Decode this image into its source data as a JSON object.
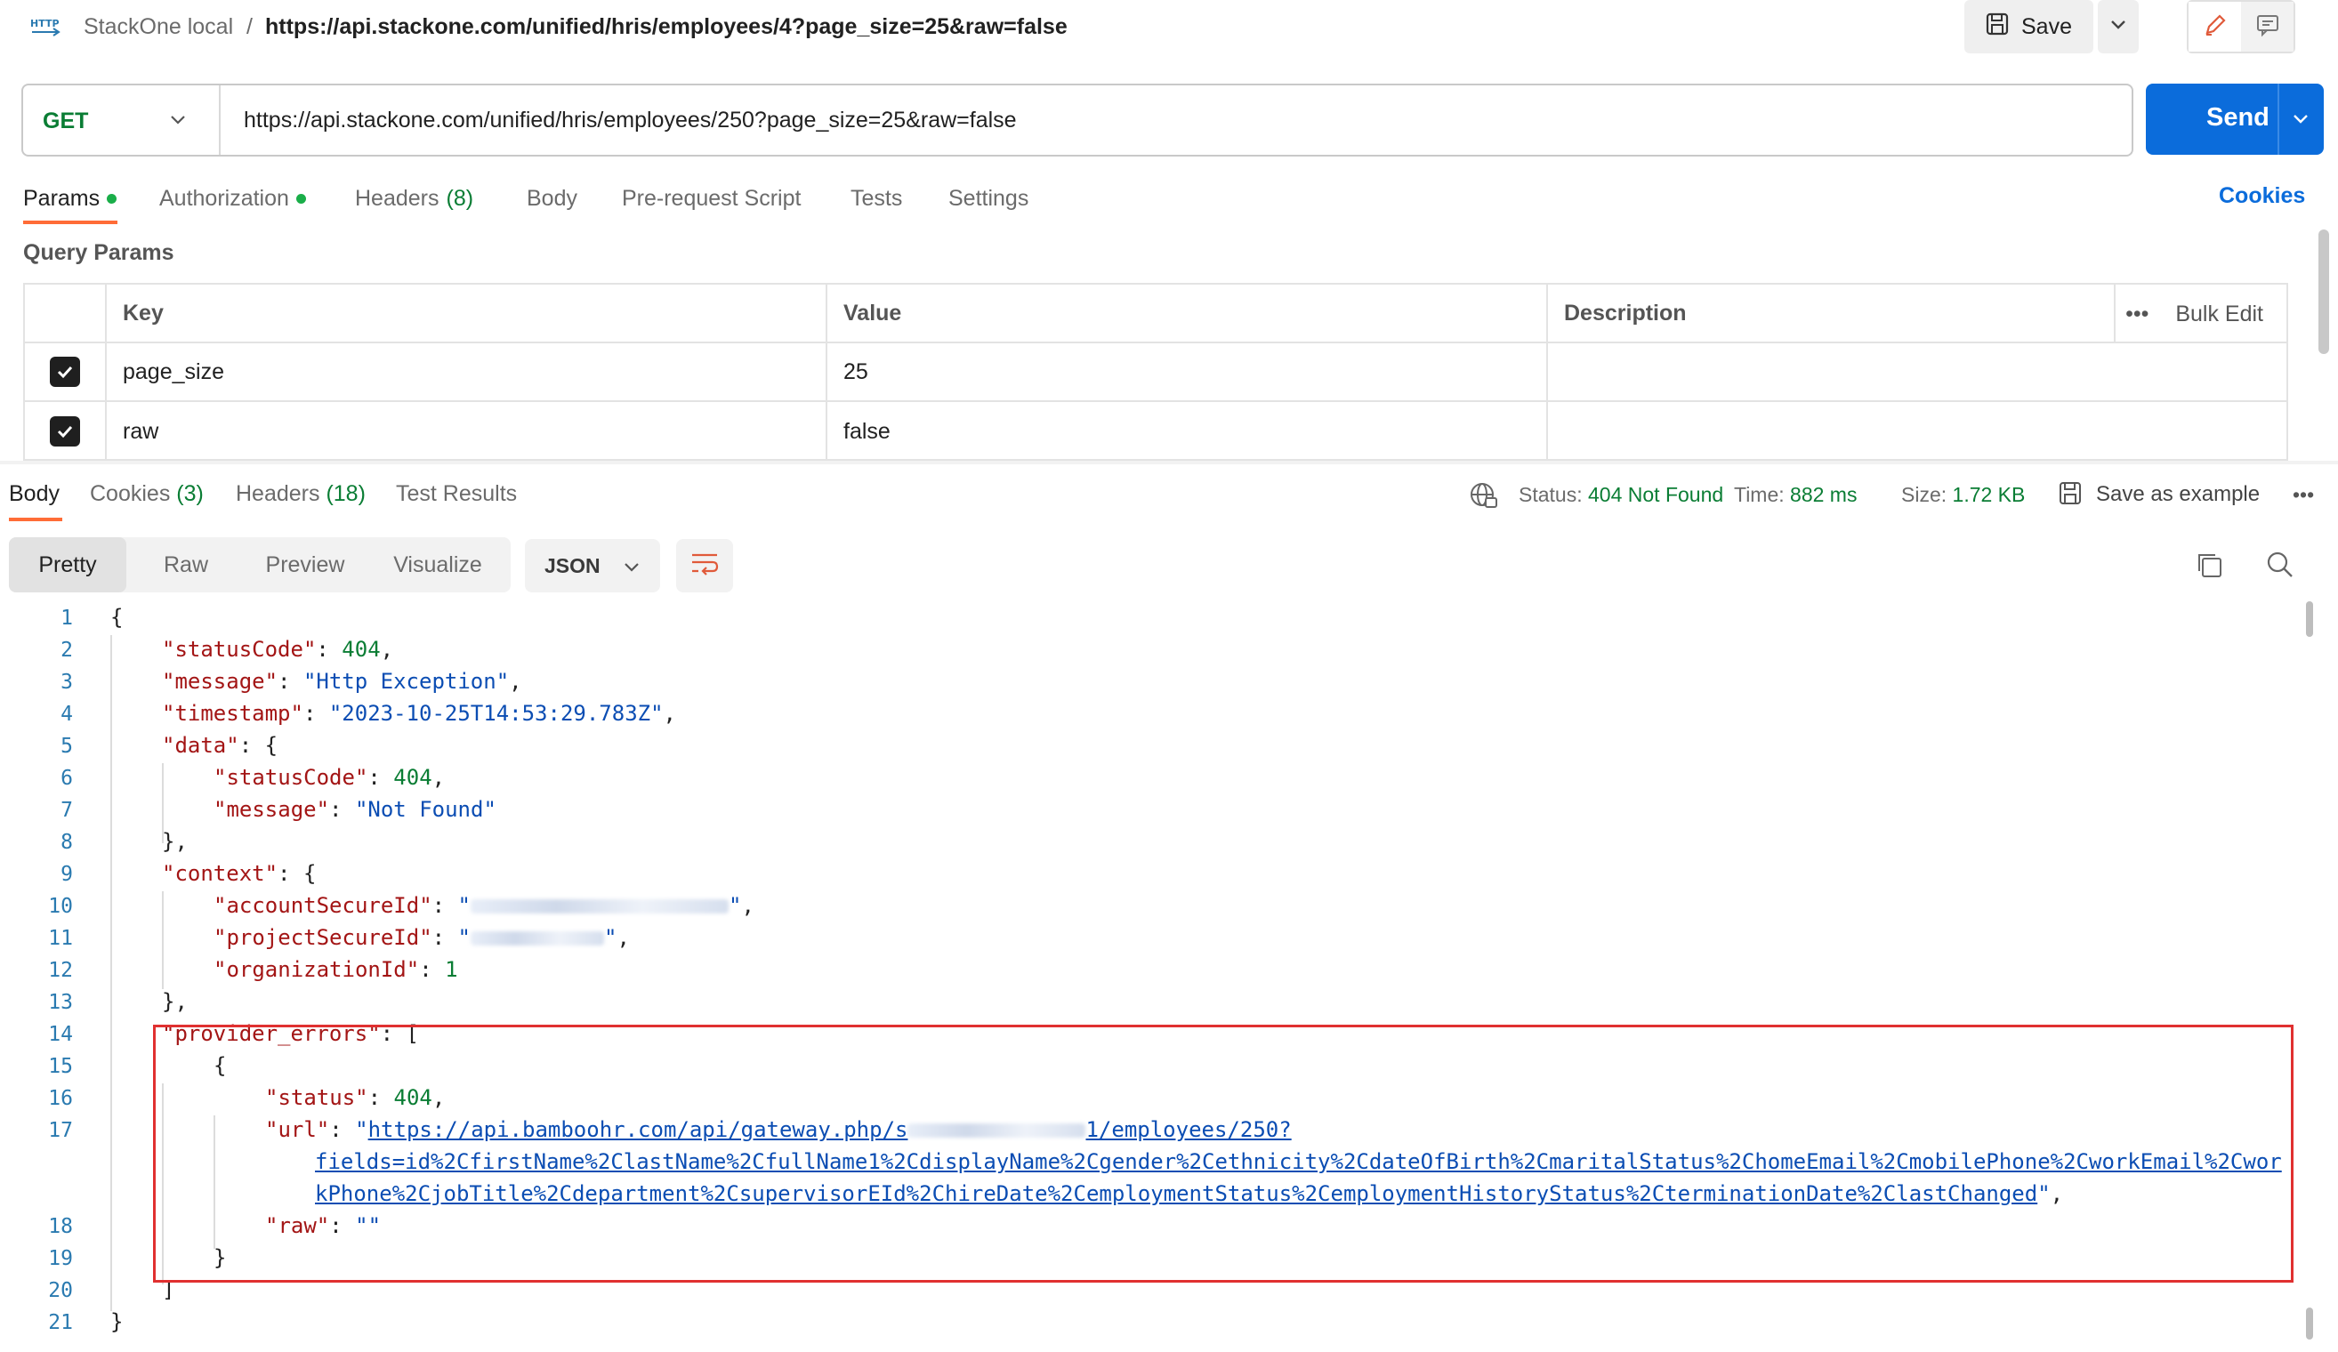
{
  "header": {
    "collection": "StackOne local",
    "separator": "/",
    "request_title": "https://api.stackone.com/unified/hris/employees/4?page_size=25&raw=false",
    "save_label": "Save"
  },
  "request": {
    "method": "GET",
    "url": "https://api.stackone.com/unified/hris/employees/250?page_size=25&raw=false",
    "send_label": "Send"
  },
  "request_tabs": {
    "params": "Params",
    "authorization": "Authorization",
    "headers": "Headers",
    "headers_count": "(8)",
    "body": "Body",
    "prerequest": "Pre-request Script",
    "tests": "Tests",
    "settings": "Settings",
    "cookies": "Cookies"
  },
  "query_params": {
    "label": "Query Params",
    "columns": {
      "key": "Key",
      "value": "Value",
      "description": "Description"
    },
    "bulk_edit": "Bulk Edit",
    "more": "•••",
    "rows": [
      {
        "key": "page_size",
        "value": "25",
        "checked": true
      },
      {
        "key": "raw",
        "value": "false",
        "checked": true
      }
    ]
  },
  "response": {
    "tabs": {
      "body": "Body",
      "cookies": "Cookies",
      "cookies_count": "(3)",
      "headers": "Headers",
      "headers_count": "(18)",
      "test_results": "Test Results"
    },
    "status_label": "Status:",
    "status_value": "404 Not Found",
    "time_label": "Time:",
    "time_value": "882 ms",
    "size_label": "Size:",
    "size_value": "1.72 KB",
    "save_example": "Save as example",
    "more": "•••",
    "views": {
      "pretty": "Pretty",
      "raw": "Raw",
      "preview": "Preview",
      "visualize": "Visualize"
    },
    "format": "JSON"
  },
  "code": {
    "line_numbers": [
      "1",
      "2",
      "3",
      "4",
      "5",
      "6",
      "7",
      "8",
      "9",
      "10",
      "11",
      "12",
      "13",
      "14",
      "15",
      "16",
      "17",
      "18",
      "19",
      "20",
      "21"
    ],
    "json": {
      "statusCode_key": "\"statusCode\"",
      "statusCode_val": "404",
      "message_key": "\"message\"",
      "message_val": "\"Http Exception\"",
      "timestamp_key": "\"timestamp\"",
      "timestamp_val": "\"2023-10-25T14:53:29.783Z\"",
      "data_key": "\"data\"",
      "data_statusCode_key": "\"statusCode\"",
      "data_statusCode_val": "404",
      "data_message_key": "\"message\"",
      "data_message_val": "\"Not Found\"",
      "context_key": "\"context\"",
      "account_key": "\"accountSecureId\"",
      "project_key": "\"projectSecureId\"",
      "organization_key": "\"organizationId\"",
      "organization_val": "1",
      "provider_errors_key": "\"provider_errors\"",
      "status_key": "\"status\"",
      "status_val": "404",
      "url_key": "\"url\"",
      "url_line1_a": "https://api.bamboohr.com/api/gateway.php/s",
      "url_line1_b": "1/employees/250?",
      "url_line2": "fields=id%2CfirstName%2ClastName%2CfullName1%2CdisplayName%2Cgender%2Cethnicity%2CdateOfBirth%2CmaritalStatus%2ChomeEmail%2CmobilePhone%2CworkEmail%2Cwor",
      "url_line3": "kPhone%2CjobTitle%2Cdepartment%2CsupervisorEId%2ChireDate%2CemploymentStatus%2CemploymentHistoryStatus%2CterminationDate%2ClastChanged",
      "raw_key": "\"raw\"",
      "raw_val": "\"\""
    }
  }
}
